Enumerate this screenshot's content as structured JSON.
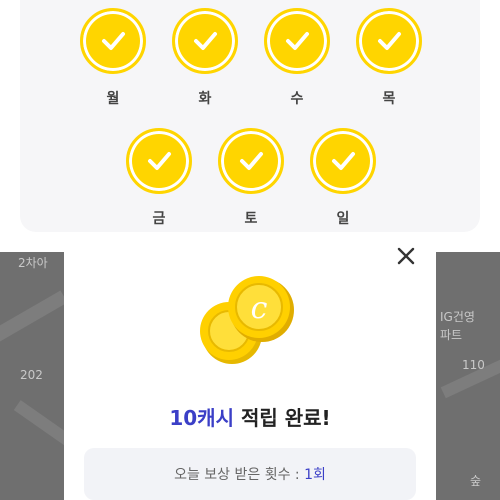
{
  "attendance": {
    "days": [
      {
        "label": "월",
        "checked": true
      },
      {
        "label": "화",
        "checked": true
      },
      {
        "label": "수",
        "checked": true
      },
      {
        "label": "목",
        "checked": true
      },
      {
        "label": "금",
        "checked": true
      },
      {
        "label": "토",
        "checked": true
      },
      {
        "label": "일",
        "checked": true
      }
    ]
  },
  "map": {
    "labels": [
      "2차아",
      "202",
      "IG건영",
      "파트",
      "110",
      "숲"
    ]
  },
  "modal": {
    "close_icon": "close-icon",
    "coin_letter": "c",
    "title_amount": "10캐시",
    "title_rest": " 적립 완료!",
    "count_label": "오늘 보상 받은 횟수 : ",
    "count_value": "1회"
  },
  "colors": {
    "coin_yellow": "#ffd500",
    "accent_blue": "#3b3fc7"
  }
}
